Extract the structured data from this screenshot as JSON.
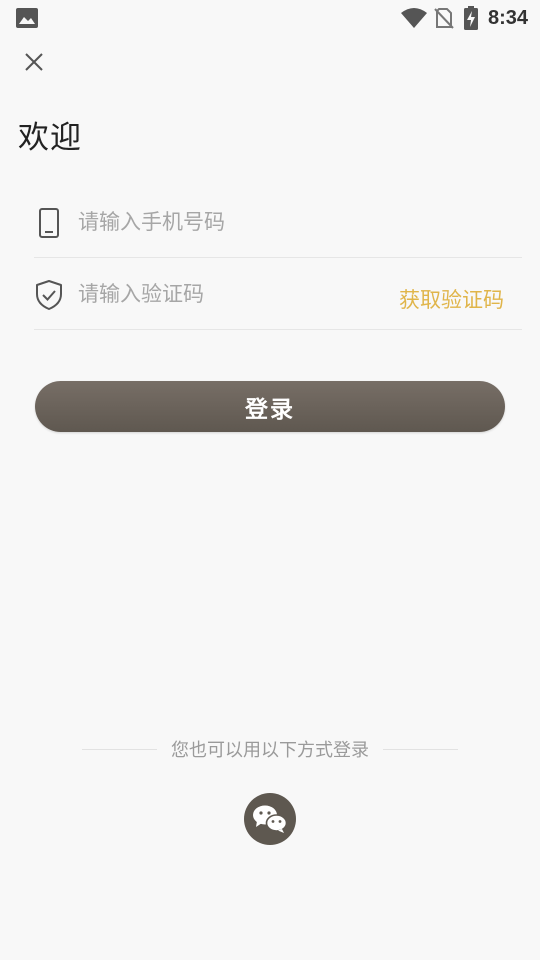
{
  "status_bar": {
    "time": "8:34",
    "icons": [
      "gallery-icon",
      "wifi-icon",
      "no-sim-icon",
      "battery-charging-icon"
    ]
  },
  "header": {
    "close_icon": "close-icon",
    "title": "欢迎"
  },
  "form": {
    "phone": {
      "icon": "mobile-phone-icon",
      "placeholder": "请输入手机号码",
      "value": ""
    },
    "code": {
      "icon": "shield-check-icon",
      "placeholder": "请输入验证码",
      "value": "",
      "get_code_label": "获取验证码"
    },
    "login_label": "登录"
  },
  "alt_login": {
    "label": "您也可以用以下方式登录",
    "options": [
      {
        "icon": "wechat-icon"
      }
    ]
  },
  "colors": {
    "background": "#f8f8f8",
    "accent": "#e0b54a",
    "button": "#6b645c",
    "placeholder": "#a6a6a6"
  }
}
